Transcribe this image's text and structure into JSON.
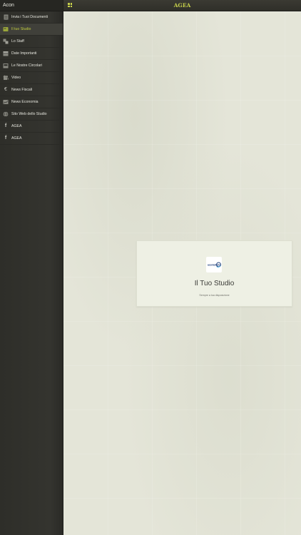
{
  "sidebar": {
    "title": "Acon",
    "items": [
      {
        "label": "Invia i Tuoi Documenti",
        "icon": "document-icon"
      },
      {
        "label": "Il tuo Studio",
        "icon": "studio-icon",
        "active": true
      },
      {
        "label": "Lo Staff",
        "icon": "staff-icon"
      },
      {
        "label": "Date Importanti",
        "icon": "calendar-icon"
      },
      {
        "label": "Le Nostre Circolari",
        "icon": "inbox-icon"
      },
      {
        "label": "Video",
        "icon": "video-camera-icon"
      },
      {
        "label": "News Fiscali",
        "icon": "euro-icon"
      },
      {
        "label": "News Economia",
        "icon": "chart-icon"
      },
      {
        "label": "Sito Web dello Studio",
        "icon": "globe-icon"
      },
      {
        "label": "AGEA",
        "icon": "facebook-icon"
      },
      {
        "label": "AGEA",
        "icon": "facebook-icon"
      }
    ]
  },
  "header": {
    "title": "AGEA",
    "menu_icon": "grid-icon"
  },
  "card": {
    "title": "Il Tuo Studio",
    "subtitle": "Sempre a tua disposizione",
    "logo_text": "acontoitalia"
  },
  "colors": {
    "accent": "#c6d04a",
    "sidebar_bg": "#32322d",
    "main_bg": "#e4e5d8",
    "card_bg": "#eef0e4"
  }
}
